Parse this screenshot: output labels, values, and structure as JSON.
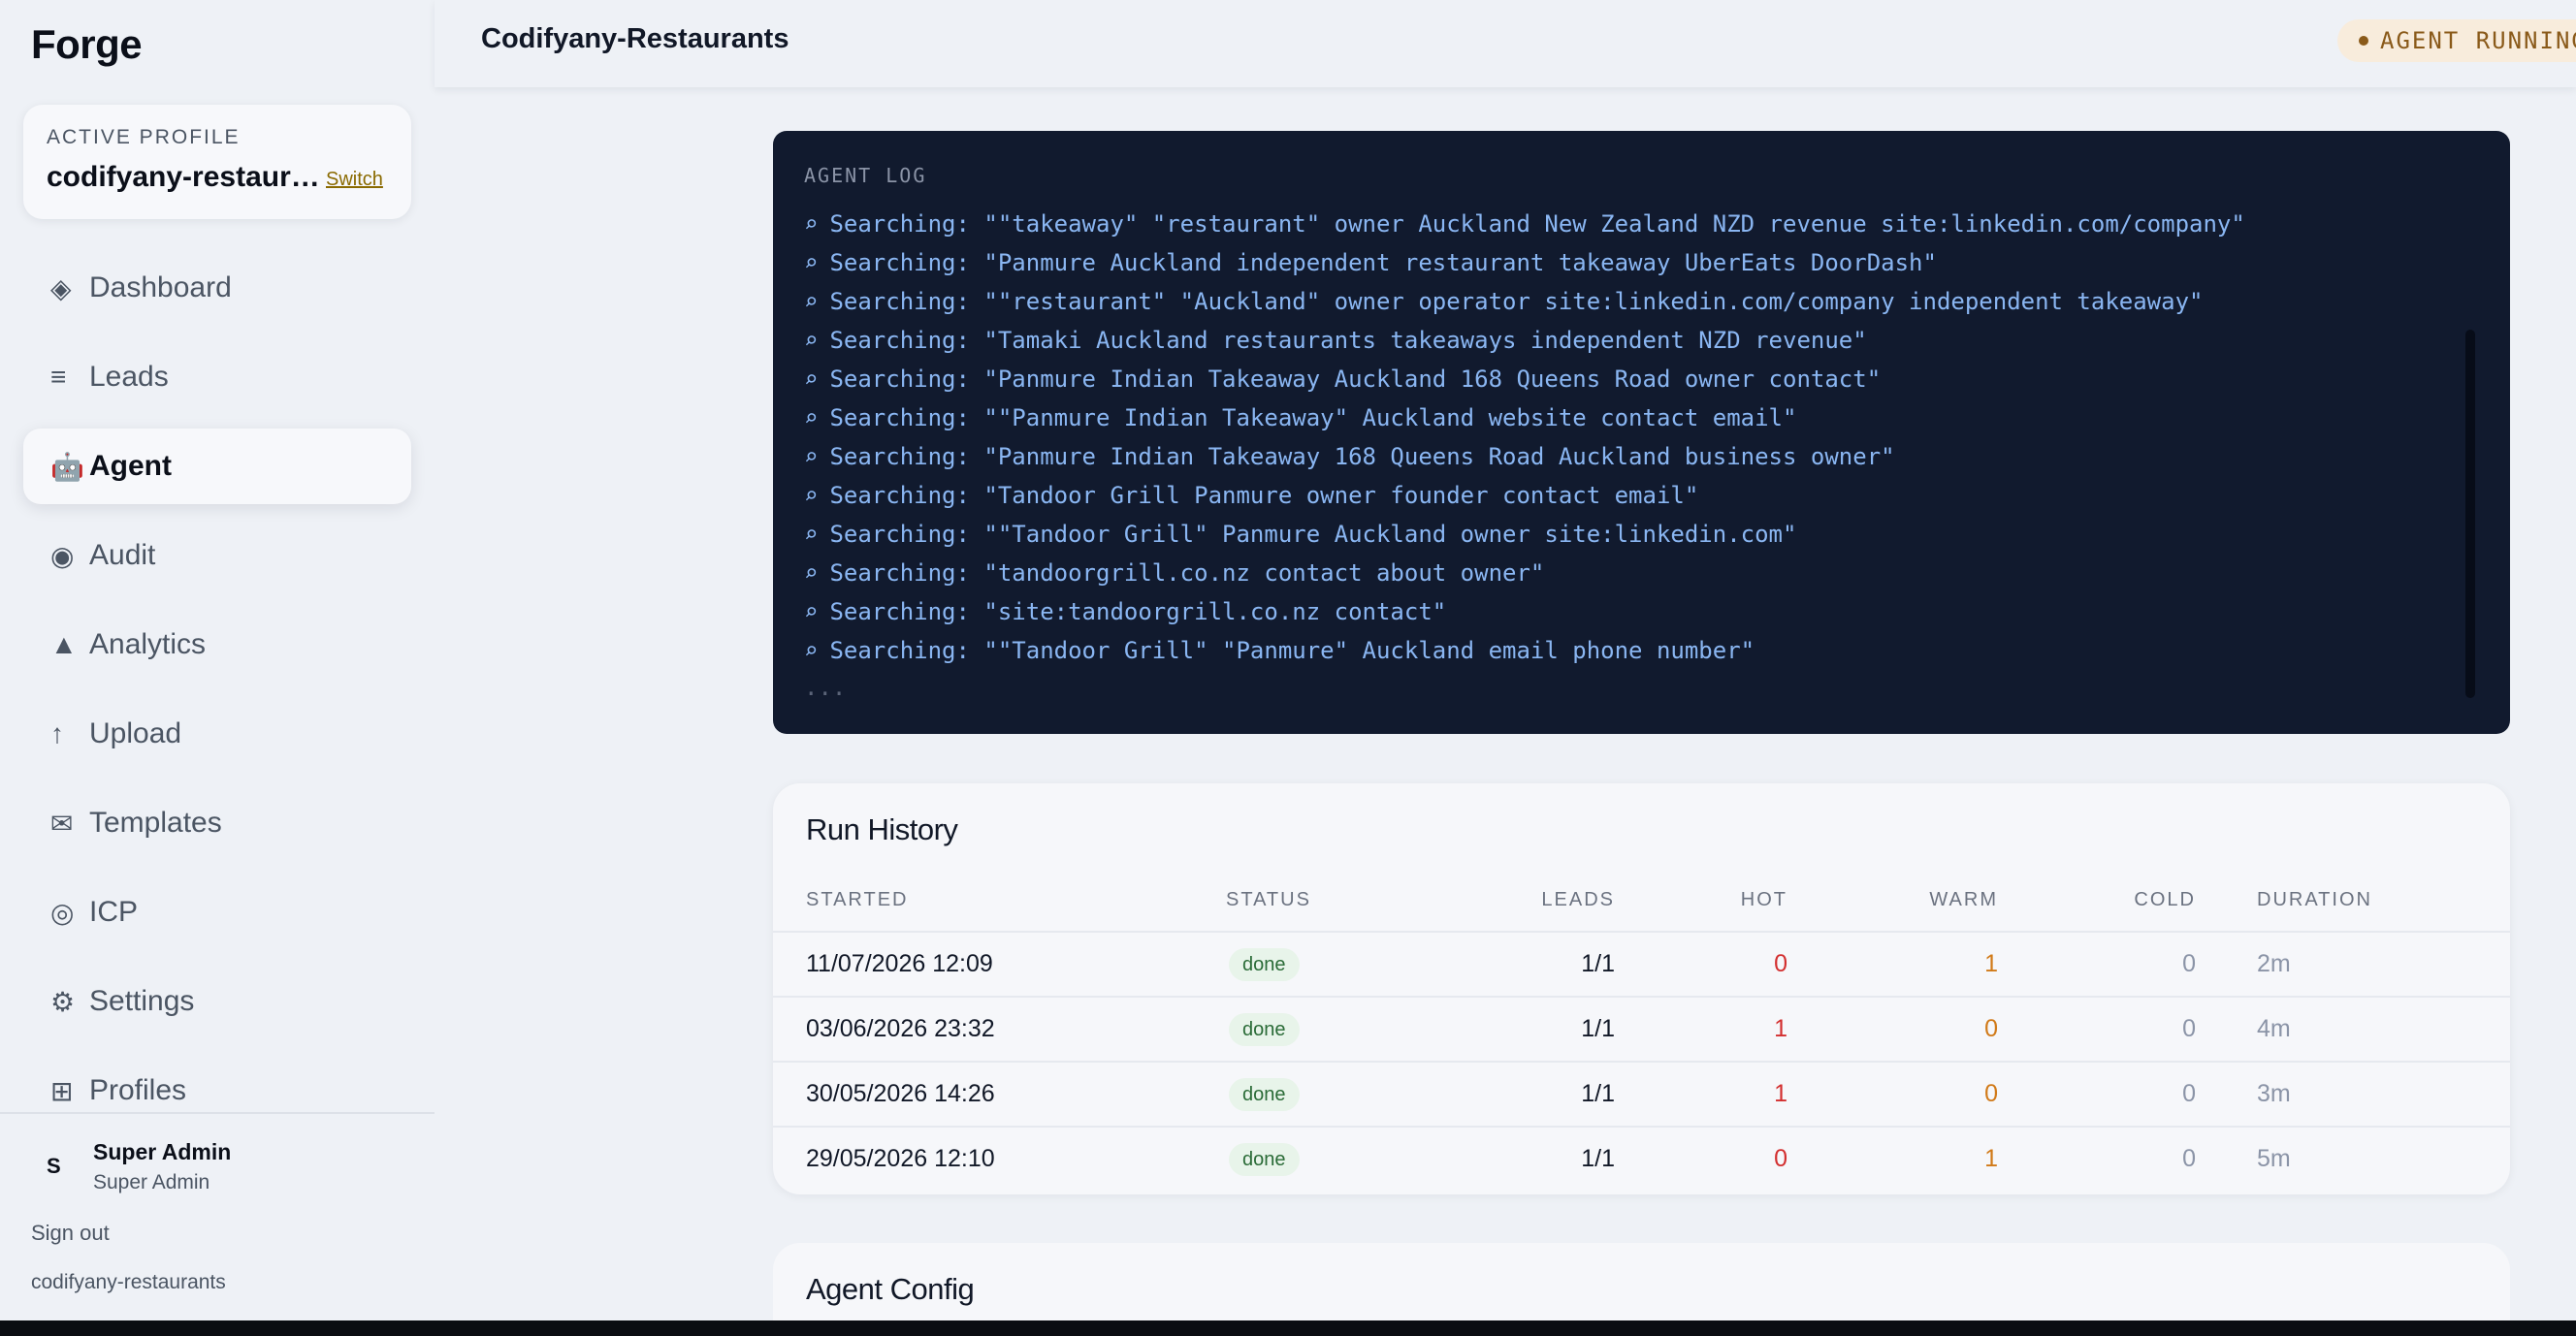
{
  "brand": "Forge",
  "profile_card": {
    "label": "ACTIVE PROFILE",
    "name": "codifyany-restaurants",
    "switch": "Switch"
  },
  "nav": [
    {
      "label": "Dashboard",
      "icon": "◈",
      "icon_name": "diamond-icon"
    },
    {
      "label": "Leads",
      "icon": "≡",
      "icon_name": "list-icon"
    },
    {
      "label": "Agent",
      "icon": "🤖",
      "icon_name": "robot-icon"
    },
    {
      "label": "Audit",
      "icon": "◉",
      "icon_name": "target-icon"
    },
    {
      "label": "Analytics",
      "icon": "▲",
      "icon_name": "triangle-icon"
    },
    {
      "label": "Upload",
      "icon": "↑",
      "icon_name": "upload-arrow-icon"
    },
    {
      "label": "Templates",
      "icon": "✉",
      "icon_name": "envelope-icon"
    },
    {
      "label": "ICP",
      "icon": "◎",
      "icon_name": "bullseye-icon"
    },
    {
      "label": "Settings",
      "icon": "⚙",
      "icon_name": "gear-icon"
    },
    {
      "label": "Profiles",
      "icon": "⊞",
      "icon_name": "grid-icon"
    }
  ],
  "active_nav": "Agent",
  "user": {
    "avatar": "S",
    "name": "Super Admin",
    "role": "Super Admin"
  },
  "sign_out": "Sign out",
  "footer_profile": "codifyany-restaurants",
  "header": {
    "title": "Codifyany-Restaurants",
    "status": "AGENT RUNNING"
  },
  "agent_log": {
    "title": "AGENT LOG",
    "icon": "⌕",
    "lines": [
      "Searching: \"\"takeaway\" \"restaurant\" owner Auckland New Zealand NZD revenue site:linkedin.com/company\"",
      "Searching: \"Panmure Auckland independent restaurant takeaway UberEats DoorDash\"",
      "Searching: \"\"restaurant\" \"Auckland\" owner operator site:linkedin.com/company independent takeaway\"",
      "Searching: \"Tamaki Auckland restaurants takeaways independent NZD revenue\"",
      "Searching: \"Panmure Indian Takeaway Auckland 168 Queens Road owner contact\"",
      "Searching: \"\"Panmure Indian Takeaway\" Auckland website contact email\"",
      "Searching: \"Panmure Indian Takeaway 168 Queens Road Auckland business owner\"",
      "Searching: \"Tandoor Grill Panmure owner founder contact email\"",
      "Searching: \"\"Tandoor Grill\" Panmure Auckland owner site:linkedin.com\"",
      "Searching: \"tandoorgrill.co.nz contact about owner\"",
      "Searching: \"site:tandoorgrill.co.nz contact\"",
      "Searching: \"\"Tandoor Grill\" \"Panmure\" Auckland email phone number\""
    ],
    "more": "..."
  },
  "run_history": {
    "title": "Run History",
    "columns": [
      "STARTED",
      "STATUS",
      "LEADS",
      "HOT",
      "WARM",
      "COLD",
      "DURATION"
    ],
    "rows": [
      {
        "started": "11/07/2026 12:09",
        "status": "done",
        "leads": "1/1",
        "hot": "0",
        "warm": "1",
        "cold": "0",
        "duration": "2m"
      },
      {
        "started": "03/06/2026 23:32",
        "status": "done",
        "leads": "1/1",
        "hot": "1",
        "warm": "0",
        "cold": "0",
        "duration": "4m"
      },
      {
        "started": "30/05/2026 14:26",
        "status": "done",
        "leads": "1/1",
        "hot": "1",
        "warm": "0",
        "cold": "0",
        "duration": "3m"
      },
      {
        "started": "29/05/2026 12:10",
        "status": "done",
        "leads": "1/1",
        "hot": "0",
        "warm": "1",
        "cold": "0",
        "duration": "5m"
      }
    ]
  },
  "agent_config": {
    "title": "Agent Config"
  },
  "colors": {
    "accent": "#8a6a00",
    "hot": "#d32f2f",
    "warm": "#d17a18",
    "log_bg": "#111a2e",
    "log_text": "#8ab6f2"
  }
}
